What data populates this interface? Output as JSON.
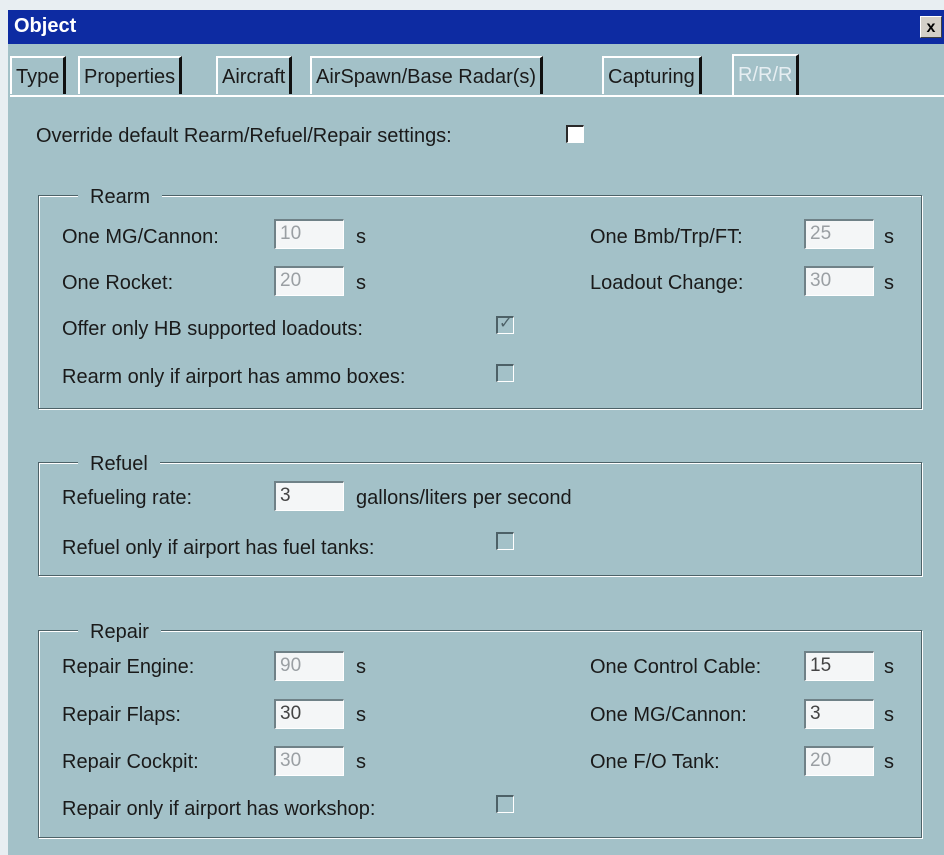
{
  "window": {
    "title": "Object",
    "close_glyph": "x"
  },
  "tabs": [
    {
      "label": "Type",
      "active": false
    },
    {
      "label": "Properties",
      "active": false
    },
    {
      "label": "Aircraft",
      "active": false
    },
    {
      "label": "AirSpawn/Base Radar(s)",
      "active": false
    },
    {
      "label": "Capturing",
      "active": false
    },
    {
      "label": "R/R/R",
      "active": true
    }
  ],
  "override": {
    "label": "Override default Rearm/Refuel/Repair settings:",
    "checked": false
  },
  "rearm": {
    "title": "Rearm",
    "mg_cannon": {
      "label": "One MG/Cannon:",
      "value": "10",
      "unit": "s"
    },
    "bmb_trp_ft": {
      "label": "One Bmb/Trp/FT:",
      "value": "25",
      "unit": "s"
    },
    "rocket": {
      "label": "One Rocket:",
      "value": "20",
      "unit": "s"
    },
    "loadout_change": {
      "label": "Loadout Change:",
      "value": "30",
      "unit": "s"
    },
    "hb_loadouts": {
      "label": "Offer only HB supported loadouts:",
      "checked": true
    },
    "ammo_boxes": {
      "label": "Rearm only if airport has ammo boxes:",
      "checked": false
    }
  },
  "refuel": {
    "title": "Refuel",
    "rate": {
      "label": "Refueling rate:",
      "value": "3",
      "unit": "gallons/liters per second"
    },
    "fuel_tanks": {
      "label": "Refuel only if airport has fuel tanks:",
      "checked": false
    }
  },
  "repair": {
    "title": "Repair",
    "engine": {
      "label": "Repair Engine:",
      "value": "90",
      "unit": "s"
    },
    "control_cable": {
      "label": "One Control Cable:",
      "value": "15",
      "unit": "s"
    },
    "flaps": {
      "label": "Repair Flaps:",
      "value": "30",
      "unit": "s"
    },
    "mg_cannon": {
      "label": "One MG/Cannon:",
      "value": "3",
      "unit": "s"
    },
    "cockpit": {
      "label": "Repair Cockpit:",
      "value": "30",
      "unit": "s"
    },
    "fo_tank": {
      "label": "One F/O Tank:",
      "value": "20",
      "unit": "s"
    },
    "workshop": {
      "label": "Repair only if airport has workshop:",
      "checked": false
    }
  },
  "colors": {
    "titlebar": "#0d2ba2",
    "panel": "#a3c1c8"
  }
}
